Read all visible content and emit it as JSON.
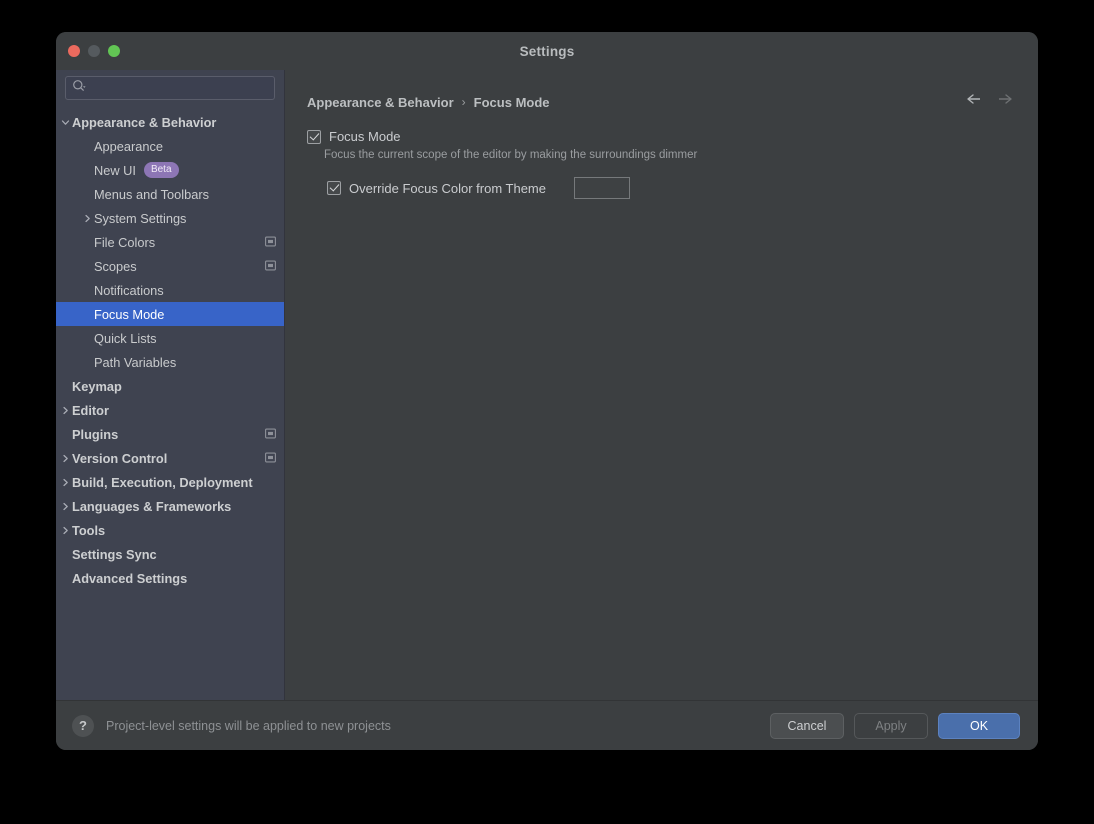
{
  "window": {
    "title": "Settings",
    "traffic_lights": [
      "close-red",
      "minimize-gray",
      "zoom-green"
    ]
  },
  "sidebar": {
    "search": {
      "value": "",
      "placeholder": "",
      "icon": "search-icon"
    },
    "items": [
      {
        "label": "Appearance & Behavior",
        "level": 0,
        "bold": true,
        "twisty": "down",
        "selected": false,
        "badge": null,
        "proj_icon": false
      },
      {
        "label": "Appearance",
        "level": 1,
        "bold": false,
        "twisty": "none",
        "selected": false,
        "badge": null,
        "proj_icon": false
      },
      {
        "label": "New UI",
        "level": 1,
        "bold": false,
        "twisty": "none",
        "selected": false,
        "badge": "Beta",
        "proj_icon": false
      },
      {
        "label": "Menus and Toolbars",
        "level": 1,
        "bold": false,
        "twisty": "none",
        "selected": false,
        "badge": null,
        "proj_icon": false
      },
      {
        "label": "System Settings",
        "level": 1,
        "bold": false,
        "twisty": "right",
        "selected": false,
        "badge": null,
        "proj_icon": false
      },
      {
        "label": "File Colors",
        "level": 1,
        "bold": false,
        "twisty": "none",
        "selected": false,
        "badge": null,
        "proj_icon": true
      },
      {
        "label": "Scopes",
        "level": 1,
        "bold": false,
        "twisty": "none",
        "selected": false,
        "badge": null,
        "proj_icon": true
      },
      {
        "label": "Notifications",
        "level": 1,
        "bold": false,
        "twisty": "none",
        "selected": false,
        "badge": null,
        "proj_icon": false
      },
      {
        "label": "Focus Mode",
        "level": 1,
        "bold": false,
        "twisty": "none",
        "selected": true,
        "badge": null,
        "proj_icon": false
      },
      {
        "label": "Quick Lists",
        "level": 1,
        "bold": false,
        "twisty": "none",
        "selected": false,
        "badge": null,
        "proj_icon": false
      },
      {
        "label": "Path Variables",
        "level": 1,
        "bold": false,
        "twisty": "none",
        "selected": false,
        "badge": null,
        "proj_icon": false
      },
      {
        "label": "Keymap",
        "level": 0,
        "bold": true,
        "twisty": "none",
        "selected": false,
        "badge": null,
        "proj_icon": false
      },
      {
        "label": "Editor",
        "level": 0,
        "bold": true,
        "twisty": "right",
        "selected": false,
        "badge": null,
        "proj_icon": false
      },
      {
        "label": "Plugins",
        "level": 0,
        "bold": true,
        "twisty": "none",
        "selected": false,
        "badge": null,
        "proj_icon": true
      },
      {
        "label": "Version Control",
        "level": 0,
        "bold": true,
        "twisty": "right",
        "selected": false,
        "badge": null,
        "proj_icon": true
      },
      {
        "label": "Build, Execution, Deployment",
        "level": 0,
        "bold": true,
        "twisty": "right",
        "selected": false,
        "badge": null,
        "proj_icon": false
      },
      {
        "label": "Languages & Frameworks",
        "level": 0,
        "bold": true,
        "twisty": "right",
        "selected": false,
        "badge": null,
        "proj_icon": false
      },
      {
        "label": "Tools",
        "level": 0,
        "bold": true,
        "twisty": "right",
        "selected": false,
        "badge": null,
        "proj_icon": false
      },
      {
        "label": "Settings Sync",
        "level": 0,
        "bold": true,
        "twisty": "none",
        "selected": false,
        "badge": null,
        "proj_icon": false
      },
      {
        "label": "Advanced Settings",
        "level": 0,
        "bold": true,
        "twisty": "none",
        "selected": false,
        "badge": null,
        "proj_icon": false
      }
    ]
  },
  "content": {
    "breadcrumb": {
      "parent": "Appearance & Behavior",
      "separator": "›",
      "current": "Focus Mode"
    },
    "nav": {
      "back_icon": "arrow-left-icon",
      "forward_icon": "arrow-right-icon"
    },
    "focus_mode": {
      "label": "Focus Mode",
      "checked": true,
      "description": "Focus the current scope of the editor by making the surroundings dimmer"
    },
    "override_color": {
      "label": "Override Focus Color from Theme",
      "checked": true,
      "swatch_color": "#3e4143"
    }
  },
  "footer": {
    "help_icon": "question-mark-icon",
    "note": "Project-level settings will be applied to new projects",
    "cancel_label": "Cancel",
    "apply_label": "Apply",
    "ok_label": "OK"
  },
  "colors": {
    "selection_blue": "#3864c8",
    "primary_button": "#4a6fab",
    "badge_purple": "#8d76b5",
    "sidebar_bg": "#3f4350",
    "panel_bg": "#3c3f41"
  }
}
